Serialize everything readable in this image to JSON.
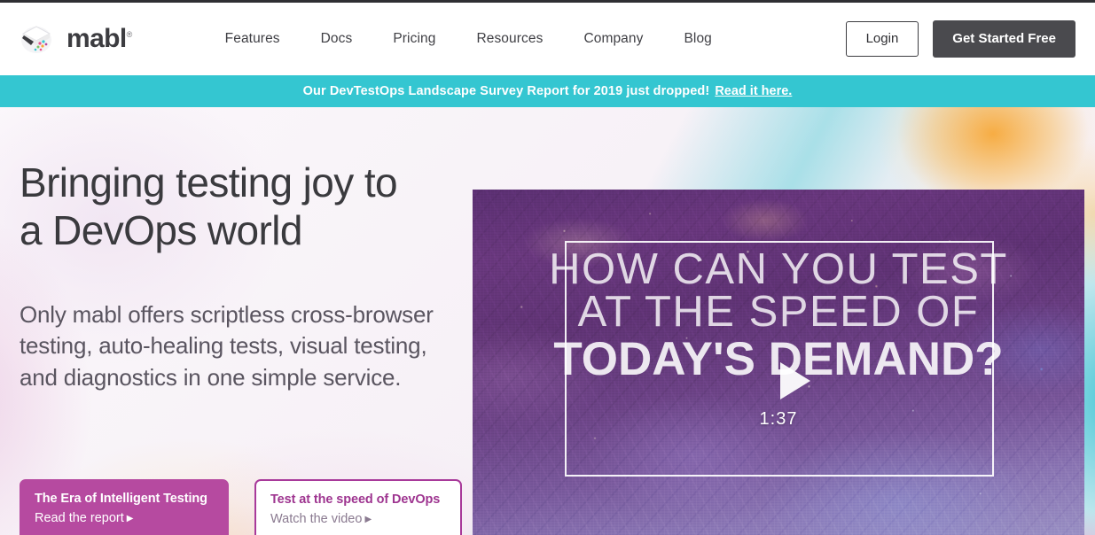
{
  "header": {
    "logo": {
      "icon": "mabl-layers-icon",
      "wordmark": "mabl",
      "trademark": "®"
    },
    "nav": [
      {
        "label": "Features"
      },
      {
        "label": "Docs"
      },
      {
        "label": "Pricing"
      },
      {
        "label": "Resources"
      },
      {
        "label": "Company"
      },
      {
        "label": "Blog"
      }
    ],
    "login_label": "Login",
    "cta_label": "Get Started Free"
  },
  "banner": {
    "text": "Our DevTestOps Landscape Survey Report for 2019 just dropped!",
    "link_label": "Read it here.",
    "background": "#34c6d1"
  },
  "hero": {
    "title_line1": "Bringing testing joy to",
    "title_line2": "a DevOps world",
    "subtitle": "Only mabl offers scriptless cross-browser testing, auto-healing tests, visual testing, and diagnostics in one simple service.",
    "cards": [
      {
        "title": "The Era of Intelligent Testing",
        "link_label": "Read the report",
        "arrow": "▶",
        "style": "filled",
        "color": "#b64aa0"
      },
      {
        "title": "Test at the speed of DevOps",
        "link_label": "Watch the video",
        "arrow": "▶",
        "style": "outlined",
        "color": "#a8399a"
      }
    ]
  },
  "video": {
    "headline_line1": "HOW CAN YOU TEST",
    "headline_line2": "AT THE SPEED OF",
    "headline_line3": "TODAY'S DEMAND?",
    "duration": "1:37",
    "play_icon": "play-triangle-icon"
  }
}
